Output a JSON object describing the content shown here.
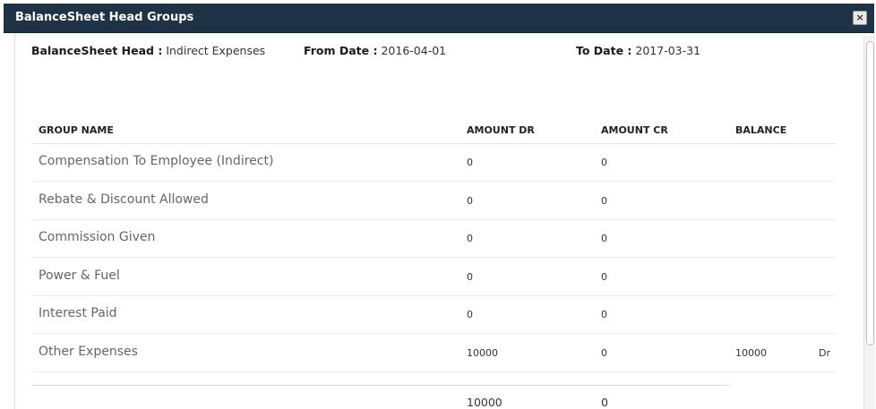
{
  "modal": {
    "title": "BalanceSheet Head Groups",
    "close_label": "×"
  },
  "filters": {
    "head_label": "BalanceSheet Head :",
    "head_value": "Indirect Expenses",
    "from_label": "From Date :",
    "from_value": "2016-04-01",
    "to_label": "To Date :",
    "to_value": "2017-03-31"
  },
  "table": {
    "columns": [
      "GROUP NAME",
      "AMOUNT DR",
      "AMOUNT CR",
      "BALANCE"
    ],
    "rows": [
      {
        "name": "Compensation To Employee (Indirect)",
        "dr": "0",
        "cr": "0",
        "balance": "",
        "type": ""
      },
      {
        "name": "Rebate & Discount Allowed",
        "dr": "0",
        "cr": "0",
        "balance": "",
        "type": ""
      },
      {
        "name": "Commission Given",
        "dr": "0",
        "cr": "0",
        "balance": "",
        "type": ""
      },
      {
        "name": "Power & Fuel",
        "dr": "0",
        "cr": "0",
        "balance": "",
        "type": ""
      },
      {
        "name": "Interest Paid",
        "dr": "0",
        "cr": "0",
        "balance": "",
        "type": ""
      },
      {
        "name": "Other Expenses",
        "dr": "10000",
        "cr": "0",
        "balance": "10000",
        "type": "Dr"
      }
    ],
    "totals": {
      "dr": "10000",
      "cr": "0"
    }
  }
}
